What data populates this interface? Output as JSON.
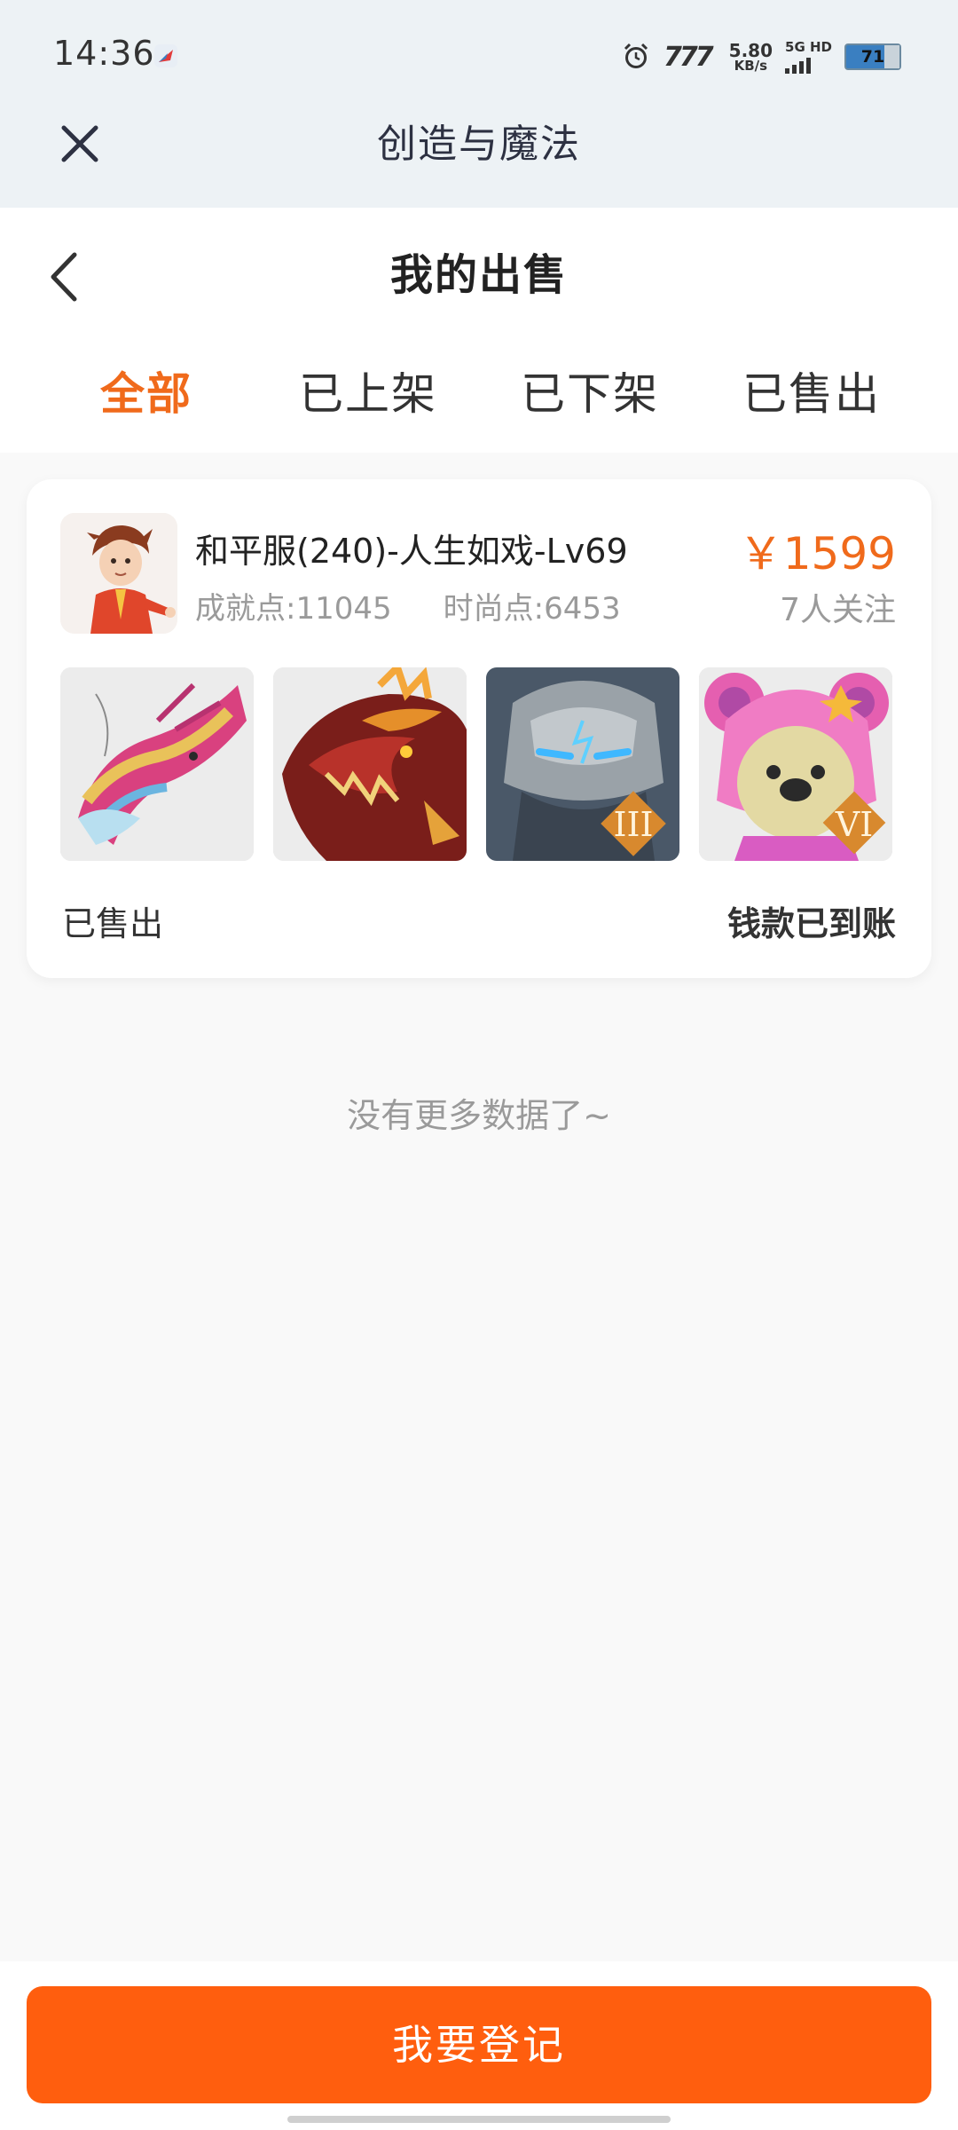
{
  "status_bar": {
    "time": "14:36",
    "vpn_label": "777",
    "speed_value": "5.80",
    "speed_unit": "KB/s",
    "network_label": "5G HD",
    "battery": "71"
  },
  "webview": {
    "title": "创造与魔法",
    "close_icon": "close-icon"
  },
  "page": {
    "title": "我的出售",
    "back_icon": "chevron-left-icon"
  },
  "tabs": [
    {
      "label": "全部",
      "active": true
    },
    {
      "label": "已上架",
      "active": false
    },
    {
      "label": "已下架",
      "active": false
    },
    {
      "label": "已售出",
      "active": false
    }
  ],
  "listing": {
    "title": "和平服(240)-人生如戏-Lv69",
    "achievement": "成就点:11045",
    "fashion": "时尚点:6453",
    "price": "￥1599",
    "followers": "7人关注",
    "status": "已售出",
    "payment_status": "钱款已到账",
    "thumbnails": [
      {
        "name": "rainbow-dragon-mount",
        "badge": ""
      },
      {
        "name": "fire-dragon-mount",
        "badge": ""
      },
      {
        "name": "stone-golem-mount",
        "badge": "III"
      },
      {
        "name": "pink-bear-costume",
        "badge": "VI"
      }
    ]
  },
  "footer_note": "没有更多数据了~",
  "register_button": "我要登记",
  "colors": {
    "accent": "#f06a1b",
    "button": "#ff5e0e",
    "header_bg": "#edf2f5"
  }
}
